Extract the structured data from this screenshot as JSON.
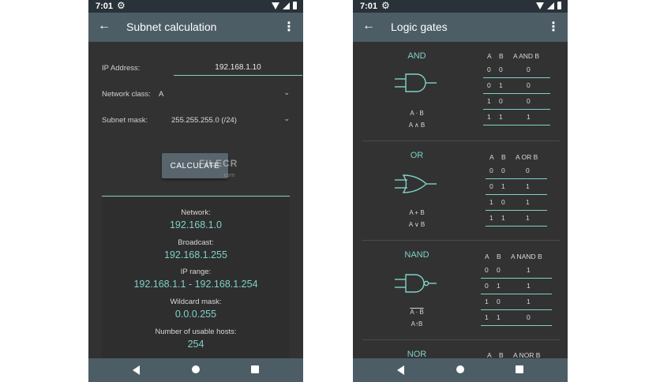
{
  "status_bar": {
    "time": "7:01"
  },
  "subnet_screen": {
    "title": "Subnet calculation",
    "ip_label": "IP Address:",
    "ip_value": "192.168.1.10",
    "class_label": "Network class:",
    "class_value": "A",
    "mask_label": "Subnet mask:",
    "mask_value": "255.255.255.0  (/24)",
    "calculate_label": "CALCULATE",
    "watermark": "FILECR",
    "watermark_small": ".com",
    "results": [
      {
        "label": "Network:",
        "value": "192.168.1.0"
      },
      {
        "label": "Broadcast:",
        "value": "192.168.1.255"
      },
      {
        "label": "IP range:",
        "value": "192.168.1.1 - 192.168.1.254"
      },
      {
        "label": "Wildcard mask:",
        "value": "0.0.0.255"
      },
      {
        "label": "Number of usable hosts:",
        "value": "254"
      }
    ]
  },
  "logic_screen": {
    "title": "Logic gates",
    "gates": [
      {
        "name": "AND",
        "expr1": "A · B",
        "expr2": "A ∧ B",
        "header": [
          "A",
          "B",
          "A AND B"
        ],
        "rows": [
          [
            "0",
            "0",
            "0"
          ],
          [
            "0",
            "1",
            "0"
          ],
          [
            "1",
            "0",
            "0"
          ],
          [
            "1",
            "1",
            "1"
          ]
        ]
      },
      {
        "name": "OR",
        "expr1": "A + B",
        "expr2": "A ∨ B",
        "header": [
          "A",
          "B",
          "A OR B"
        ],
        "rows": [
          [
            "0",
            "0",
            "0"
          ],
          [
            "0",
            "1",
            "1"
          ],
          [
            "1",
            "0",
            "1"
          ],
          [
            "1",
            "1",
            "1"
          ]
        ]
      },
      {
        "name": "NAND",
        "expr1": "A · B",
        "expr2": "A↑B",
        "header": [
          "A",
          "B",
          "A NAND B"
        ],
        "rows": [
          [
            "0",
            "0",
            "1"
          ],
          [
            "0",
            "1",
            "1"
          ],
          [
            "1",
            "0",
            "1"
          ],
          [
            "1",
            "1",
            "0"
          ]
        ]
      },
      {
        "name": "NOR",
        "header": [
          "A",
          "B",
          "A NOR B"
        ]
      }
    ]
  },
  "nav_icons": [
    "back-icon",
    "home-icon",
    "recents-icon"
  ],
  "colors": {
    "accent": "#7fd1c7",
    "app_bar": "#4c5d66",
    "background": "#323232"
  }
}
